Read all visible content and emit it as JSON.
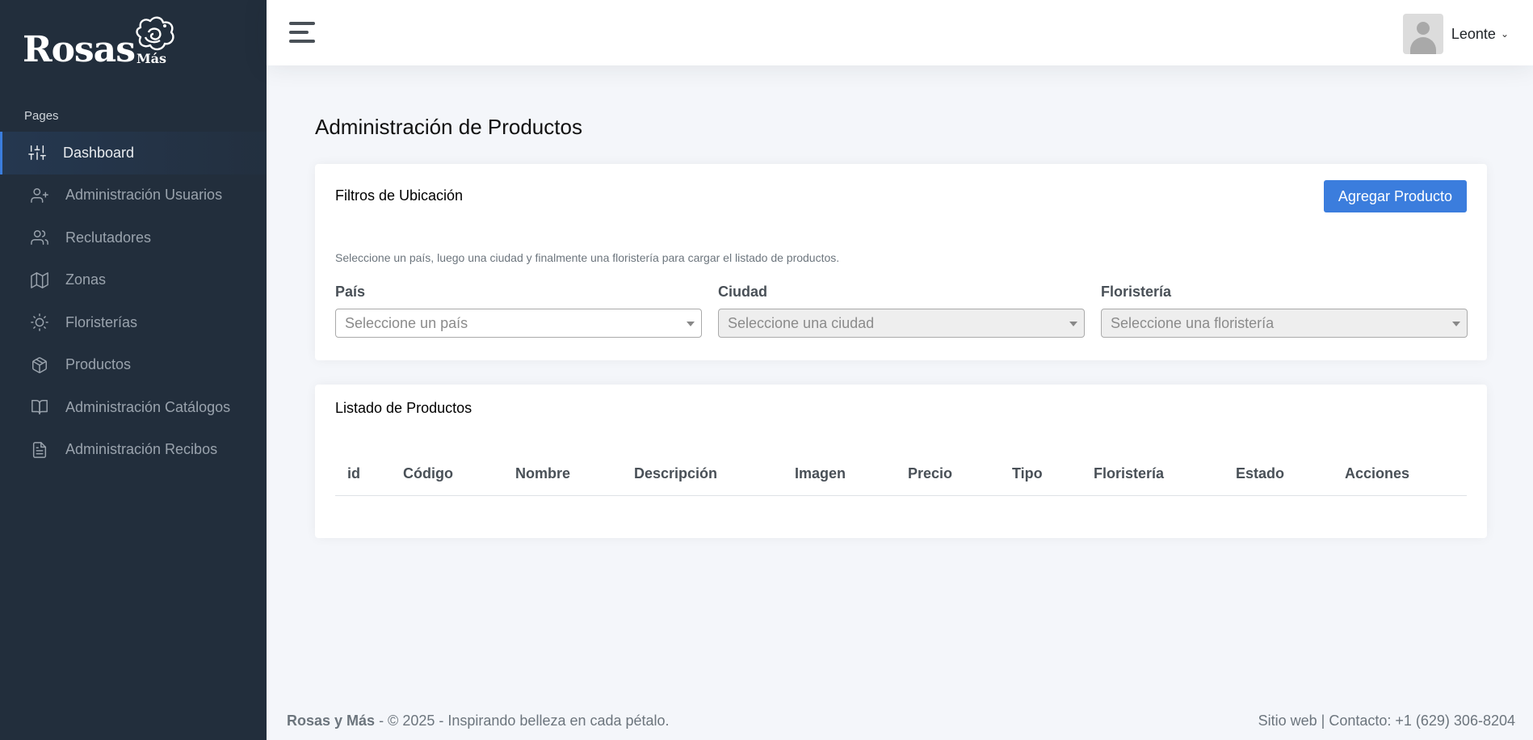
{
  "brand": {
    "name": "Rosas",
    "sub": "y Más"
  },
  "sidebar": {
    "header": "Pages",
    "items": [
      {
        "label": "Dashboard",
        "icon": "sliders-icon"
      },
      {
        "label": "Administración Usuarios",
        "icon": "user-plus-icon"
      },
      {
        "label": "Reclutadores",
        "icon": "users-icon"
      },
      {
        "label": "Zonas",
        "icon": "map-icon"
      },
      {
        "label": "Floristerías",
        "icon": "sun-icon"
      },
      {
        "label": "Productos",
        "icon": "package-icon"
      },
      {
        "label": "Administración Catálogos",
        "icon": "book-open-icon"
      },
      {
        "label": "Administración Recibos",
        "icon": "file-text-icon"
      }
    ]
  },
  "topbar": {
    "user_name": "Leonte"
  },
  "page": {
    "title": "Administración de Productos"
  },
  "filters": {
    "title": "Filtros de Ubicación",
    "add_button": "Agregar Producto",
    "help": "Seleccione un país, luego una ciudad y finalmente una floristería para cargar el listado de productos.",
    "pais": {
      "label": "País",
      "placeholder": "Seleccione un país"
    },
    "ciudad": {
      "label": "Ciudad",
      "placeholder": "Seleccione una ciudad"
    },
    "floristeria": {
      "label": "Floristería",
      "placeholder": "Seleccione una floristería"
    }
  },
  "list": {
    "title": "Listado de Productos",
    "columns": [
      "id",
      "Código",
      "Nombre",
      "Descripción",
      "Imagen",
      "Precio",
      "Tipo",
      "Floristería",
      "Estado",
      "Acciones"
    ]
  },
  "footer": {
    "brand": "Rosas y Más",
    "text": " - © 2025 - Inspirando belleza en cada pétalo.",
    "site_link": "Sitio web",
    "separator": "|",
    "contact": "Contacto: +1 (629) 306-8204"
  },
  "colors": {
    "sidebar_bg": "#222e3c",
    "accent": "#3b7ddd",
    "page_bg": "#f4f6fa"
  }
}
